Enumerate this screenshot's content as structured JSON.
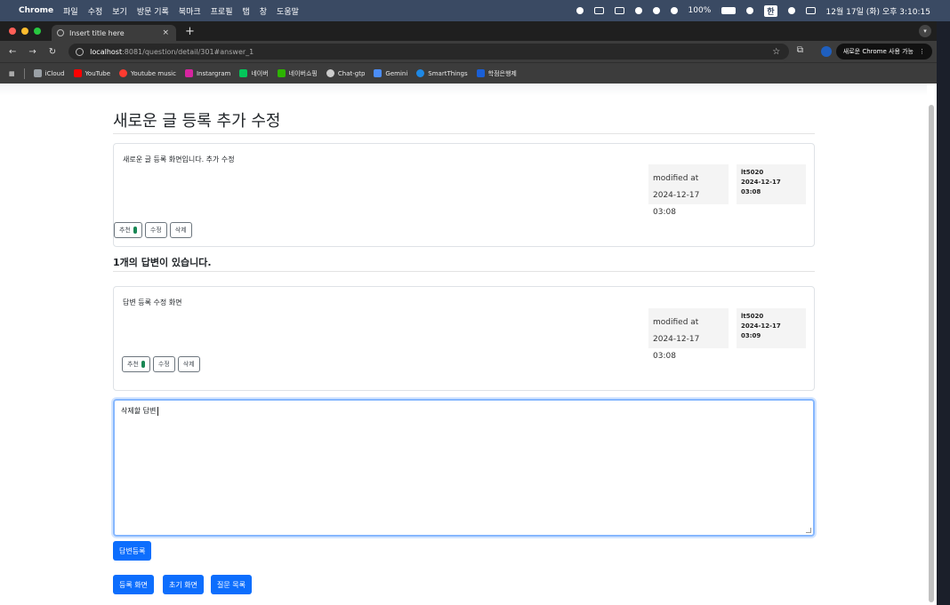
{
  "menubar": {
    "app": "Chrome",
    "menus": [
      "파일",
      "수정",
      "보기",
      "방문 기록",
      "북마크",
      "프로필",
      "탭",
      "창",
      "도움말"
    ],
    "battery": "100%",
    "input_method": "한",
    "datetime": "12월 17일 (화) 오후 3:10:15"
  },
  "browser": {
    "tab_title": "Insert title here",
    "tab_close": "×",
    "new_tab": "+",
    "url_host": "localhost",
    "url_path": ":8081/question/detail/301#answer_1",
    "profile_label": "새로운 Chrome 사용 가능",
    "bookmarks": [
      {
        "label": "iCloud",
        "color": "#9aa0a6"
      },
      {
        "label": "YouTube",
        "color": "#ff0000"
      },
      {
        "label": "Youtube music",
        "color": "#ff3b30"
      },
      {
        "label": "Instargram",
        "color": "#d6249f"
      },
      {
        "label": "네이버",
        "color": "#03c75a"
      },
      {
        "label": "네이버쇼핑",
        "color": "#2db400"
      },
      {
        "label": "Chat-gtp",
        "color": "#cccccc"
      },
      {
        "label": "Gemini",
        "color": "#4b8df8"
      },
      {
        "label": "SmartThings",
        "color": "#1e88e5"
      },
      {
        "label": "학점은행제",
        "color": "#1a5fd6"
      }
    ]
  },
  "question": {
    "title": "새로운 글 등록 추가 수정",
    "content": "새로운 글 등록 화면입니다. 추가 수정",
    "modified_label": "modified at",
    "modified_date": "2024-12-17 03:08",
    "author": "lt5020",
    "author_date": "2024-12-17 03:08",
    "buttons": {
      "recommend": "추천",
      "edit": "수정",
      "delete": "삭제"
    }
  },
  "answers": {
    "count_text": "1개의 답변이 있습니다.",
    "items": [
      {
        "content": "답변 등록 수정 화면",
        "modified_label": "modified at",
        "modified_date": "2024-12-17 03:08",
        "author": "lt5020",
        "author_date": "2024-12-17 03:09",
        "buttons": {
          "recommend": "추천",
          "edit": "수정",
          "delete": "삭제"
        }
      }
    ]
  },
  "answer_form": {
    "value": "삭제할 답변",
    "submit_label": "답변등록"
  },
  "footer_buttons": {
    "register": "등록 화면",
    "home": "초기 화면",
    "list": "질문 목록"
  },
  "colors": {
    "primary": "#0d6efd",
    "recommend_badge": "#198754",
    "focus_border": "#86b7fe"
  }
}
